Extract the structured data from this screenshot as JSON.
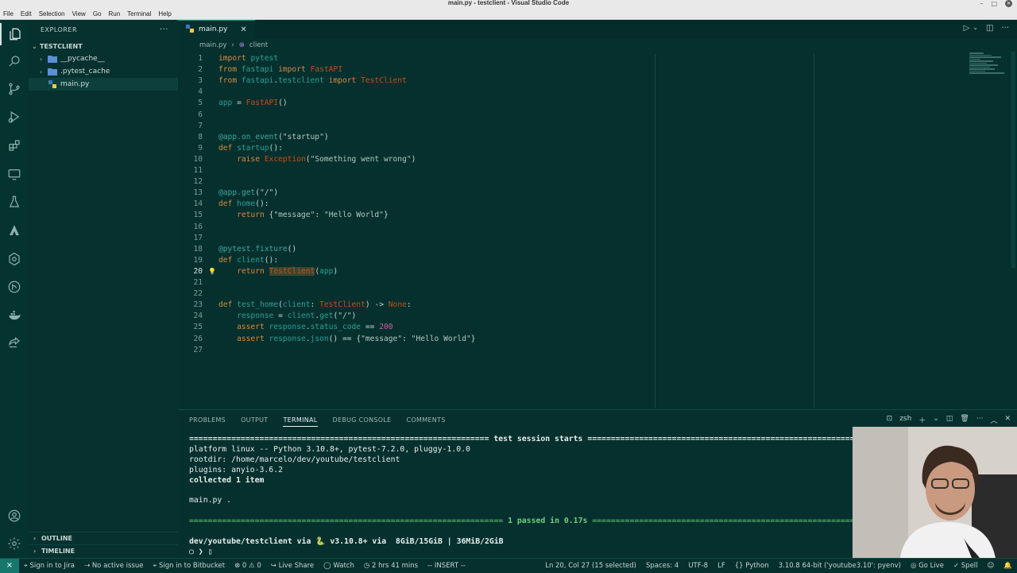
{
  "window": {
    "title": "main.py - testclient - Visual Studio Code"
  },
  "menu": [
    "File",
    "Edit",
    "Selection",
    "View",
    "Go",
    "Run",
    "Terminal",
    "Help"
  ],
  "explorer": {
    "header": "EXPLORER",
    "project": "TESTCLIENT",
    "items": [
      {
        "label": "__pycache__",
        "type": "folder"
      },
      {
        "label": ".pytest_cache",
        "type": "folder"
      },
      {
        "label": "main.py",
        "type": "python",
        "selected": true
      }
    ],
    "outline": "OUTLINE",
    "timeline": "TIMELINE"
  },
  "tab": {
    "label": "main.py"
  },
  "breadcrumb": {
    "file": "main.py",
    "symbol": "client"
  },
  "code": [
    "import pytest",
    "from fastapi import FastAPI",
    "from fastapi.testclient import TestClient",
    "",
    "app = FastAPI()",
    "",
    "",
    "@app.on_event(\"startup\")",
    "def startup():",
    "    raise Exception(\"Something went wrong\")",
    "",
    "",
    "@app.get(\"/\")",
    "def home():",
    "    return {\"message\": \"Hello World\"}",
    "",
    "",
    "@pytest.fixture()",
    "def client():",
    "    return TestClient(app)",
    "",
    "",
    "def test_home(client: TestClient) -> None:",
    "    response = client.get(\"/\")",
    "    assert response.status_code == 200",
    "    assert response.json() == {\"message\": \"Hello World\"}",
    ""
  ],
  "current_line": 20,
  "panel": {
    "tabs": [
      "PROBLEMS",
      "OUTPUT",
      "TERMINAL",
      "DEBUG CONSOLE",
      "COMMENTS"
    ],
    "active_tab": "TERMINAL",
    "shell": "zsh"
  },
  "terminal": {
    "session_banner": "================================================================ test session starts =================================================================",
    "platform": "platform linux -- Python 3.10.8+, pytest-7.2.0, pluggy-1.0.0",
    "rootdir": "rootdir: /home/marcelo/dev/youtube/testclient",
    "plugins": "plugins: anyio-3.6.2",
    "collected": "collected 1 item",
    "result_line": "main.py .",
    "passed_prefix": "=================================================================== ",
    "passed_text": "1 passed",
    "passed_time": " in 0.17s ",
    "passed_suffix": "===================================================================",
    "prompt": "dev/youtube/testclient via 🐍 v3.10.8+ via  8GiB/15GiB | 36MiB/2GiB",
    "input": "○ ❯ ▯"
  },
  "status": {
    "jira": "Sign in to Jira",
    "issue": "No active issue",
    "bitbucket": "Sign in to Bitbucket",
    "problems": "⊗ 0 ⚠ 0",
    "liveshare": "Live Share",
    "watch": "Watch",
    "time": "2 hrs 41 mins",
    "mode": "-- INSERT --",
    "position": "Ln 20, Col 27 (15 selected)",
    "spaces": "Spaces: 4",
    "encoding": "UTF-8",
    "eol": "LF",
    "language": "Python",
    "interpreter": "3.10.8 64-bit ('youtube3.10': pyenv)",
    "golive": "Go Live",
    "spell": "Spell"
  }
}
